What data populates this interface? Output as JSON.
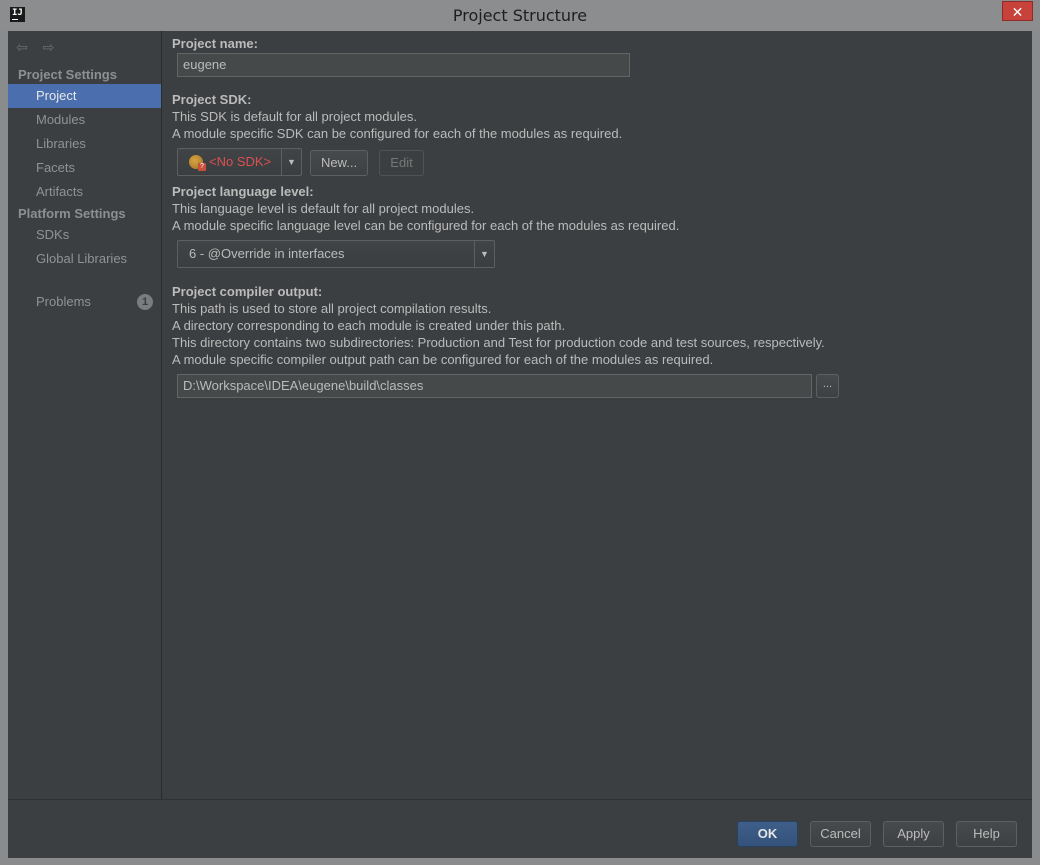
{
  "window": {
    "title": "Project Structure",
    "app_icon_text": "IJ",
    "close_glyph": "✕"
  },
  "nav": {
    "back_glyph": "⇦",
    "forward_glyph": "⇨"
  },
  "sidebar": {
    "project_settings_label": "Project Settings",
    "platform_settings_label": "Platform Settings",
    "items": [
      {
        "label": "Project"
      },
      {
        "label": "Modules"
      },
      {
        "label": "Libraries"
      },
      {
        "label": "Facets"
      },
      {
        "label": "Artifacts"
      },
      {
        "label": "SDKs"
      },
      {
        "label": "Global Libraries"
      },
      {
        "label": "Problems",
        "badge": "1"
      }
    ],
    "selected": "Project"
  },
  "project": {
    "name_label": "Project name:",
    "name_value": "eugene",
    "sdk_label": "Project SDK:",
    "sdk_desc_1": "This SDK is default for all project modules.",
    "sdk_desc_2": "A module specific SDK can be configured for each of the modules as required.",
    "sdk_value": "<No SDK>",
    "new_button": "New...",
    "edit_button": "Edit",
    "lang_label": "Project language level:",
    "lang_desc_1": "This language level is default for all project modules.",
    "lang_desc_2": "A module specific language level can be configured for each of the modules as required.",
    "lang_value": "6 - @Override in interfaces",
    "output_label": "Project compiler output:",
    "output_desc_1": "This path is used to store all project compilation results.",
    "output_desc_2": "A directory corresponding to each module is created under this path.",
    "output_desc_3": "This directory contains two subdirectories: Production and Test for production code and test sources, respectively.",
    "output_desc_4": "A module specific compiler output path can be configured for each of the modules as required.",
    "output_value": "D:\\Workspace\\IDEA\\eugene\\build\\classes",
    "browse_button": "..."
  },
  "footer": {
    "ok": "OK",
    "cancel": "Cancel",
    "apply": "Apply",
    "help": "Help"
  },
  "colors": {
    "accent": "#4b6eaf",
    "background": "#3c3f41",
    "sdk_error": "#d95050",
    "primary_button": "#3a5a84"
  }
}
